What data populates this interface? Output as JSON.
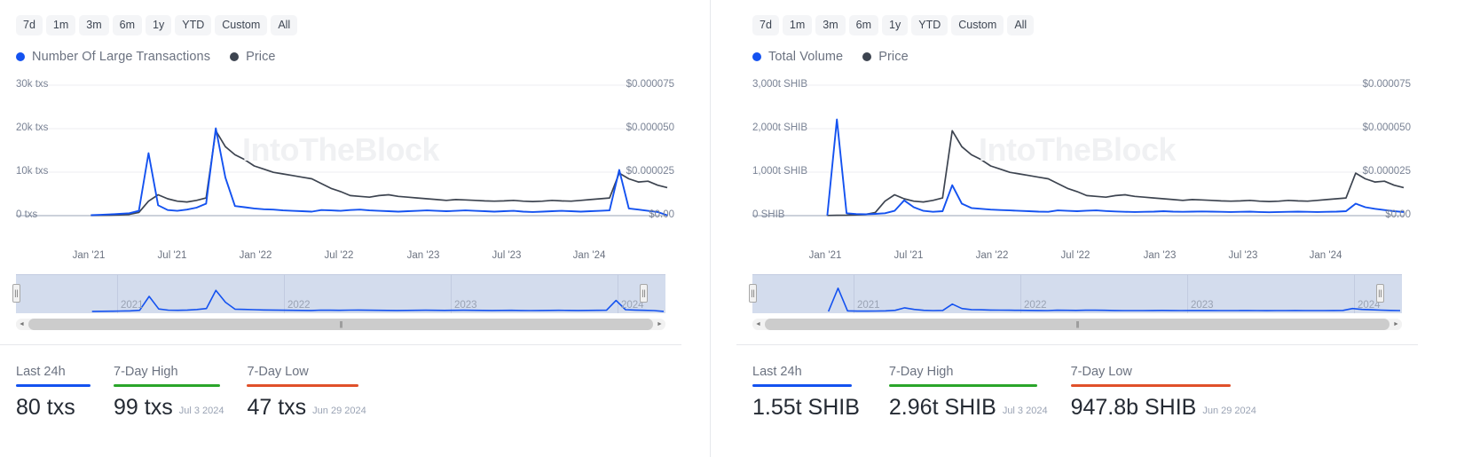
{
  "brand": {
    "watermark": "IntoTheBlock",
    "accent_blue": "#1452f0",
    "accent_dark": "#3d4450",
    "green": "#2aa52a",
    "red": "#e0502a"
  },
  "panels": [
    {
      "id": "large-transactions",
      "range_tabs": [
        "7d",
        "1m",
        "3m",
        "6m",
        "1y",
        "YTD",
        "Custom",
        "All"
      ],
      "legend": [
        {
          "label": "Number Of Large Transactions",
          "color": "#1452f0"
        },
        {
          "label": "Price",
          "color": "#3d4450"
        }
      ],
      "y_left_labels": [
        "30k txs",
        "20k txs",
        "10k txs",
        "0 txs"
      ],
      "y_right_labels": [
        "$0.000075",
        "$0.000050",
        "$0.000025",
        "$0.00"
      ],
      "x_labels": [
        "Jan '21",
        "Jul '21",
        "Jan '22",
        "Jul '22",
        "Jan '23",
        "Jul '23",
        "Jan '24"
      ],
      "navigator_years": [
        "2021",
        "2022",
        "2023",
        "2024"
      ],
      "stats": [
        {
          "title": "Last 24h",
          "value": "80 txs",
          "date": "",
          "color": "#1452f0"
        },
        {
          "title": "7-Day High",
          "value": "99 txs",
          "date": "Jul 3 2024",
          "color": "#2aa52a"
        },
        {
          "title": "7-Day Low",
          "value": "47 txs",
          "date": "Jun 29 2024",
          "color": "#e0502a"
        }
      ],
      "chart_data": {
        "type": "line",
        "title": "",
        "xlabel": "",
        "ylabel": "Number Of Large Transactions",
        "y2label": "Price",
        "ylim": [
          0,
          33000
        ],
        "y2lim": [
          0,
          8.25e-05
        ],
        "grid": true,
        "legend_position": "top-left",
        "x": [
          "Jan '21",
          "Jul '21",
          "Jan '22",
          "Jul '22",
          "Jan '23",
          "Jul '23",
          "Jan '24"
        ],
        "series": [
          {
            "name": "Number Of Large Transactions",
            "color": "#1452f0",
            "values": [
              120,
              200,
              300,
              450,
              600,
              1200,
              15600,
              2600,
              1400,
              1200,
              1500,
              2000,
              3000,
              21800,
              9500,
              2400,
              2100,
              1800,
              1600,
              1500,
              1300,
              1200,
              1100,
              1000,
              1400,
              1300,
              1200,
              1400,
              1500,
              1300,
              1200,
              1100,
              1000,
              1100,
              1200,
              1300,
              1200,
              1100,
              1200,
              1300,
              1200,
              1100,
              1000,
              1100,
              1200,
              1000,
              900,
              1000,
              1100,
              1200,
              1100,
              1000,
              1100,
              1200,
              1300,
              11400,
              1800,
              1500,
              1200,
              900,
              80
            ]
          },
          {
            "name": "Price",
            "color": "#3d4450",
            "values": [
              1e-07,
              2e-07,
              3e-07,
              5e-07,
              8e-07,
              2e-06,
              9e-06,
              1.3e-05,
              1.05e-05,
              9e-06,
              8.5e-06,
              9.5e-06,
              1.1e-05,
              5.3e-05,
              4.3e-05,
              3.8e-05,
              3.5e-05,
              3.1e-05,
              2.9e-05,
              2.7e-05,
              2.6e-05,
              2.5e-05,
              2.4e-05,
              2.3e-05,
              2e-05,
              1.7e-05,
              1.5e-05,
              1.25e-05,
              1.2e-05,
              1.15e-05,
              1.25e-05,
              1.3e-05,
              1.2e-05,
              1.15e-05,
              1.1e-05,
              1.05e-05,
              1e-05,
              9.5e-06,
              1e-05,
              9.8e-06,
              9.5e-06,
              9.2e-06,
              9e-06,
              9.2e-06,
              9.5e-06,
              9e-06,
              8.8e-06,
              9e-06,
              9.5e-06,
              9.2e-06,
              9e-06,
              9.5e-06,
              1e-05,
              1.05e-05,
              1.1e-05,
              2.65e-05,
              2.3e-05,
              2.1e-05,
              2.15e-05,
              1.9e-05,
              1.75e-05
            ]
          }
        ]
      }
    },
    {
      "id": "total-volume",
      "range_tabs": [
        "7d",
        "1m",
        "3m",
        "6m",
        "1y",
        "YTD",
        "Custom",
        "All"
      ],
      "legend": [
        {
          "label": "Total Volume",
          "color": "#1452f0"
        },
        {
          "label": "Price",
          "color": "#3d4450"
        }
      ],
      "y_left_labels": [
        "3,000t SHIB",
        "2,000t SHIB",
        "1,000t SHIB",
        "0 SHIB"
      ],
      "y_right_labels": [
        "$0.000075",
        "$0.000050",
        "$0.000025",
        "$0.00"
      ],
      "x_labels": [
        "Jan '21",
        "Jul '21",
        "Jan '22",
        "Jul '22",
        "Jan '23",
        "Jul '23",
        "Jan '24"
      ],
      "navigator_years": [
        "2021",
        "2022",
        "2023",
        "2024"
      ],
      "stats": [
        {
          "title": "Last 24h",
          "value": "1.55t SHIB",
          "date": "",
          "color": "#1452f0"
        },
        {
          "title": "7-Day High",
          "value": "2.96t SHIB",
          "date": "Jul 3 2024",
          "color": "#2aa52a"
        },
        {
          "title": "7-Day Low",
          "value": "947.8b SHIB",
          "date": "Jun 29 2024",
          "color": "#e0502a"
        }
      ],
      "chart_data": {
        "type": "line",
        "title": "",
        "xlabel": "",
        "ylabel": "Total Volume",
        "y2label": "Price",
        "ylim": [
          0,
          3300
        ],
        "y2lim": [
          0,
          8.25e-05
        ],
        "grid": true,
        "legend_position": "top-left",
        "x": [
          "Jan '21",
          "Jul '21",
          "Jan '22",
          "Jul '22",
          "Jan '23",
          "Jul '23",
          "Jan '24"
        ],
        "series": [
          {
            "name": "Total Volume",
            "color": "#1452f0",
            "values": [
              5,
              2400,
              60,
              40,
              35,
              45,
              60,
              120,
              380,
              210,
              120,
              95,
              110,
              760,
              300,
              190,
              170,
              150,
              140,
              130,
              120,
              110,
              100,
              95,
              130,
              120,
              110,
              125,
              130,
              115,
              105,
              95,
              90,
              95,
              100,
              110,
              100,
              95,
              100,
              105,
              100,
              95,
              90,
              95,
              100,
              90,
              85,
              90,
              95,
              100,
              95,
              90,
              95,
              100,
              110,
              300,
              210,
              170,
              140,
              110,
              90
            ]
          },
          {
            "name": "Price",
            "color": "#3d4450",
            "values": [
              1e-07,
              2e-07,
              3e-07,
              5e-07,
              8e-07,
              2e-06,
              9e-06,
              1.3e-05,
              1.05e-05,
              9e-06,
              8.5e-06,
              9.5e-06,
              1.1e-05,
              5.3e-05,
              4.3e-05,
              3.8e-05,
              3.5e-05,
              3.1e-05,
              2.9e-05,
              2.7e-05,
              2.6e-05,
              2.5e-05,
              2.4e-05,
              2.3e-05,
              2e-05,
              1.7e-05,
              1.5e-05,
              1.25e-05,
              1.2e-05,
              1.15e-05,
              1.25e-05,
              1.3e-05,
              1.2e-05,
              1.15e-05,
              1.1e-05,
              1.05e-05,
              1e-05,
              9.5e-06,
              1e-05,
              9.8e-06,
              9.5e-06,
              9.2e-06,
              9e-06,
              9.2e-06,
              9.5e-06,
              9e-06,
              8.8e-06,
              9e-06,
              9.5e-06,
              9.2e-06,
              9e-06,
              9.5e-06,
              1e-05,
              1.05e-05,
              1.1e-05,
              2.65e-05,
              2.3e-05,
              2.1e-05,
              2.15e-05,
              1.9e-05,
              1.75e-05
            ]
          }
        ]
      }
    }
  ],
  "scrollbar": {
    "left_arrow": "◄",
    "right_arrow": "►",
    "thumb_grip": "|||",
    "handle_grip": "||"
  }
}
